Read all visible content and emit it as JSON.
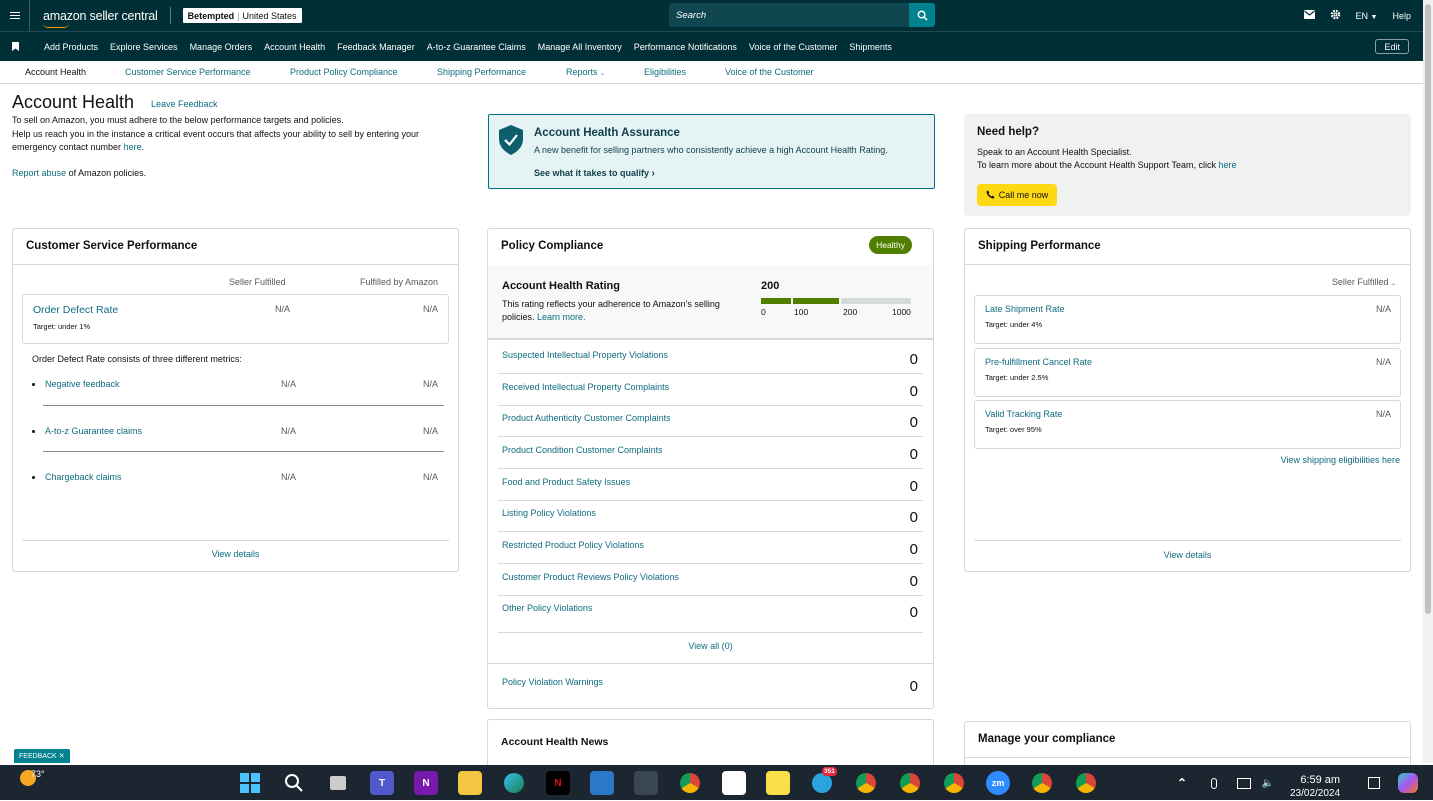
{
  "topbar": {
    "brand": "amazon seller central",
    "store": "Betempted",
    "marketplace": "United States",
    "search_placeholder": "Search",
    "language": "EN",
    "help": "Help"
  },
  "nav": {
    "items": [
      "Add Products",
      "Explore Services",
      "Manage Orders",
      "Account Health",
      "Feedback Manager",
      "A-to-z Guarantee Claims",
      "Manage All Inventory",
      "Performance Notifications",
      "Voice of the Customer",
      "Shipments"
    ],
    "edit": "Edit"
  },
  "subnav": {
    "items": [
      "Account Health",
      "Customer Service Performance",
      "Product Policy Compliance",
      "Shipping Performance",
      "Reports",
      "Eligibilities",
      "Voice of the Customer"
    ]
  },
  "page": {
    "title": "Account Health",
    "leave_feedback": "Leave Feedback",
    "intro1": "To sell on Amazon, you must adhere to the below performance targets and policies.",
    "intro2": "Help us reach you in the instance a critical event occurs that affects your ability to sell by entering your emergency contact number",
    "here": "here",
    "report_abuse": "Report abuse",
    "report_abuse_tail": "of Amazon policies."
  },
  "assurance": {
    "title": "Account Health Assurance",
    "desc": "A new benefit for selling partners who consistently achieve a high Account Health Rating.",
    "link": "See what it takes to qualify"
  },
  "help": {
    "title": "Need help?",
    "line1": "Speak to an Account Health Specialist.",
    "line2": "To learn more about the Account Health Support Team, click",
    "here": "here",
    "call": "Call me now"
  },
  "csp": {
    "title": "Customer Service Performance",
    "col1": "Seller Fulfilled",
    "col2": "Fulfilled by Amazon",
    "odr_label": "Order Defect Rate",
    "odr_target": "Target: under 1%",
    "odr_v1": "N/A",
    "odr_v2": "N/A",
    "note": "Order Defect Rate consists of three different metrics:",
    "metrics": [
      {
        "label": "Negative feedback",
        "v1": "N/A",
        "v2": "N/A"
      },
      {
        "label": "A-to-z Guarantee claims",
        "v1": "N/A",
        "v2": "N/A"
      },
      {
        "label": "Chargeback claims",
        "v1": "N/A",
        "v2": "N/A"
      }
    ],
    "view_details": "View details"
  },
  "policy": {
    "title": "Policy Compliance",
    "status": "Healthy",
    "ahr_title": "Account Health Rating",
    "ahr_desc": "This rating reflects your adherence to Amazon's selling policies.",
    "learn_more": "Learn more.",
    "score": "200",
    "ticks": [
      "0",
      "100",
      "200",
      "1000"
    ],
    "rows": [
      {
        "label": "Suspected Intellectual Property Violations",
        "value": "0"
      },
      {
        "label": "Received Intellectual Property Complaints",
        "value": "0"
      },
      {
        "label": "Product Authenticity Customer Complaints",
        "value": "0"
      },
      {
        "label": "Product Condition Customer Complaints",
        "value": "0"
      },
      {
        "label": "Food and Product Safety Issues",
        "value": "0"
      },
      {
        "label": "Listing Policy Violations",
        "value": "0"
      },
      {
        "label": "Restricted Product Policy Violations",
        "value": "0"
      },
      {
        "label": "Customer Product Reviews Policy Violations",
        "value": "0"
      },
      {
        "label": "Other Policy Violations",
        "value": "0"
      }
    ],
    "view_all": "View all (0)",
    "warnings_label": "Policy Violation Warnings",
    "warnings_value": "0"
  },
  "shipping": {
    "title": "Shipping Performance",
    "filter": "Seller Fulfilled",
    "metrics": [
      {
        "label": "Late Shipment Rate",
        "target": "Target: under 4%",
        "value": "N/A"
      },
      {
        "label": "Pre-fulfillment Cancel Rate",
        "target": "Target: under 2.5%",
        "value": "N/A"
      },
      {
        "label": "Valid Tracking Rate",
        "target": "Target: over 95%",
        "value": "N/A"
      }
    ],
    "eligibilities": "View shipping eligibilities here",
    "view_details": "View details"
  },
  "news": {
    "title": "Account Health News"
  },
  "manage": {
    "title": "Manage your compliance"
  },
  "feedback": "FEEDBACK",
  "taskbar": {
    "temp": "73°",
    "badge": "351",
    "time": "6:59 am",
    "date": "23/02/2024"
  },
  "colors": {
    "brand_dark": "#002f36",
    "link": "#0f6b80",
    "healthy": "#507f00",
    "button": "#ffd814"
  }
}
